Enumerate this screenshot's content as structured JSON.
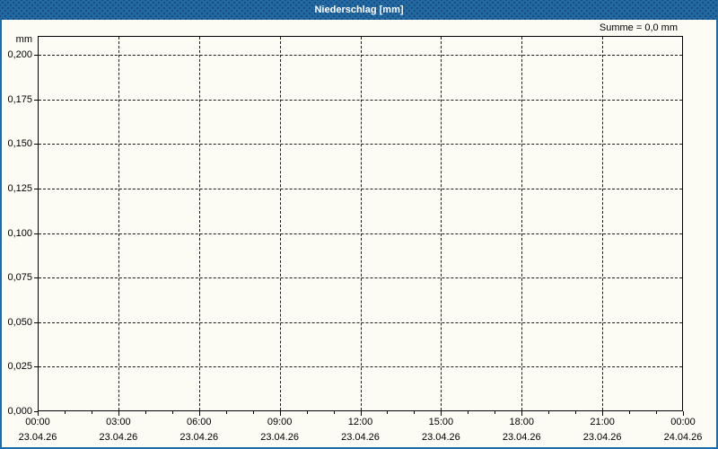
{
  "window": {
    "title": "Niederschlag [mm]"
  },
  "summary_label": "Summe = 0,0 mm",
  "chart_data": {
    "type": "bar",
    "title": "Niederschlag [mm]",
    "ylabel": "mm",
    "xlabel": "",
    "ylim": [
      0,
      0.2
    ],
    "grid": true,
    "grid_style": "dashed",
    "legend": "none",
    "summary": "Summe = 0,0 mm",
    "series": [
      {
        "name": "Niederschlag",
        "values": [],
        "sum_mm": 0.0
      }
    ],
    "x_axis": {
      "start": "23.04.26 00:00",
      "end": "24.04.26 00:00",
      "span_hours": 24,
      "major_tick_interval_hours": 3,
      "minor_tick_interval_hours": 1,
      "major_ticks": [
        {
          "hour": 0,
          "time": "00:00",
          "date": "23.04.26"
        },
        {
          "hour": 3,
          "time": "03:00",
          "date": "23.04.26"
        },
        {
          "hour": 6,
          "time": "06:00",
          "date": "23.04.26"
        },
        {
          "hour": 9,
          "time": "09:00",
          "date": "23.04.26"
        },
        {
          "hour": 12,
          "time": "12:00",
          "date": "23.04.26"
        },
        {
          "hour": 15,
          "time": "15:00",
          "date": "23.04.26"
        },
        {
          "hour": 18,
          "time": "18:00",
          "date": "23.04.26"
        },
        {
          "hour": 21,
          "time": "21:00",
          "date": "23.04.26"
        },
        {
          "hour": 24,
          "time": "00:00",
          "date": "24.04.26"
        }
      ]
    },
    "y_axis": {
      "unit": "mm",
      "ticks": [
        {
          "value": 0.2,
          "label": "0,200"
        },
        {
          "value": 0.175,
          "label": "0,175"
        },
        {
          "value": 0.15,
          "label": "0,150"
        },
        {
          "value": 0.125,
          "label": "0,125"
        },
        {
          "value": 0.1,
          "label": "0,100"
        },
        {
          "value": 0.075,
          "label": "0,075"
        },
        {
          "value": 0.05,
          "label": "0,050"
        },
        {
          "value": 0.025,
          "label": "0,025"
        },
        {
          "value": 0.0,
          "label": "0,000"
        }
      ]
    },
    "colors": {
      "titlebar": "#2268a2",
      "titlebar_text": "#ffffff",
      "panel_border": "#1e6ba8",
      "background": "#fcfcf5",
      "axis": "#000000",
      "grid": "#1c1c1c",
      "text": "#000000"
    }
  }
}
